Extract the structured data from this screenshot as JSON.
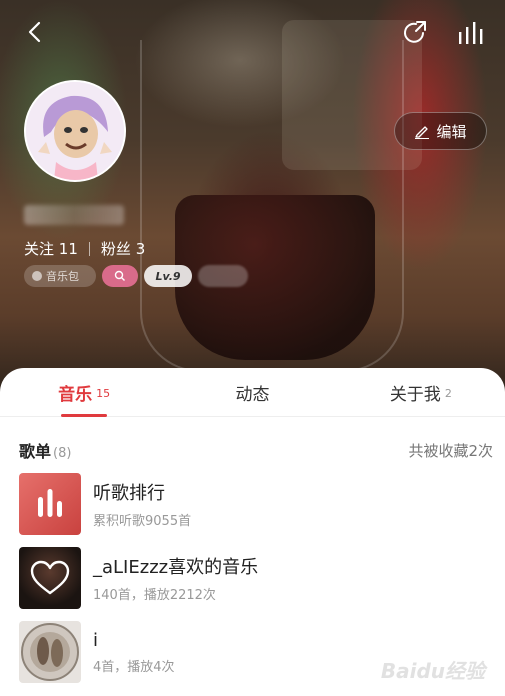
{
  "header": {
    "follow_label": "关注",
    "follow_count": "11",
    "fans_label": "粉丝",
    "fans_count": "3",
    "badges": {
      "music_pack": "音乐包",
      "level": "Lv.9"
    },
    "edit_label": "编辑"
  },
  "tabs": [
    {
      "label": "音乐",
      "count": "15"
    },
    {
      "label": "动态",
      "count": ""
    },
    {
      "label": "关于我",
      "count": "2"
    }
  ],
  "playlists_section": {
    "title": "歌单",
    "count": "(8)",
    "favorited": "共被收藏2次",
    "items": [
      {
        "title": "听歌排行",
        "subtitle": "累积听歌9055首"
      },
      {
        "title": "_aLIEzzz喜欢的音乐",
        "subtitle": "140首，播放2212次"
      },
      {
        "title": "i",
        "subtitle": "4首，播放4次"
      }
    ]
  },
  "watermark": "Baidu经验",
  "colors": {
    "accent": "#e03a3e"
  },
  "icons": [
    "back-icon",
    "share-icon",
    "stats-icon",
    "pencil-icon",
    "bars-icon",
    "heart-icon"
  ]
}
